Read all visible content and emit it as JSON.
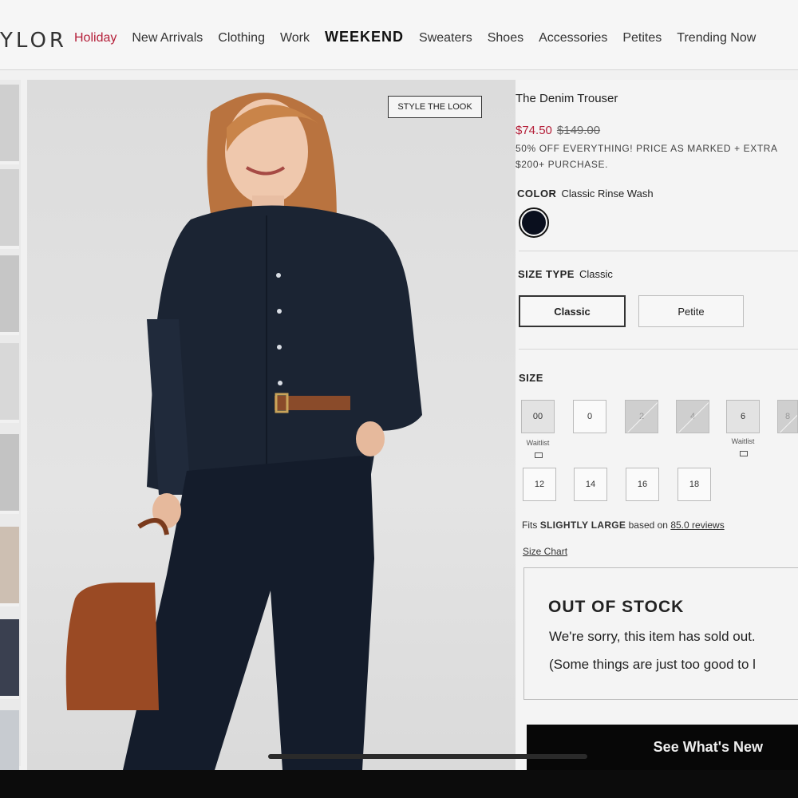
{
  "nav": {
    "brand": "YLOR",
    "links": [
      "Holiday",
      "New Arrivals",
      "Clothing",
      "Work",
      "WEEKEND",
      "Sweaters",
      "Shoes",
      "Accessories",
      "Petites",
      "Trending Now"
    ]
  },
  "photo": {
    "style_the_look": "STYLE THE LOOK"
  },
  "product": {
    "name": "The Denim Trouser",
    "sale_price": "$74.50",
    "original_price": "$149.00",
    "promo_line1": "50% OFF EVERYTHING! PRICE AS MARKED + EXTRA",
    "promo_line2": "$200+ PURCHASE.",
    "color_label": "COLOR",
    "color_value": "Classic Rinse Wash",
    "swatch_color": "#0a0f1e",
    "size_type_label": "SIZE TYPE",
    "size_type_value": "Classic",
    "size_types": [
      "Classic",
      "Petite"
    ],
    "size_label": "SIZE",
    "sizes_row1": [
      "00",
      "0",
      "2",
      "4",
      "6",
      "8"
    ],
    "sizes_row2": [
      "12",
      "14",
      "16",
      "18"
    ],
    "waitlist": "Waitlist",
    "fits_prefix": "Fits",
    "fits_value": "SLIGHTLY LARGE",
    "fits_middle": "based on",
    "fits_reviews": "85.0 reviews",
    "size_chart": "Size Chart"
  },
  "stock": {
    "title": "OUT OF STOCK",
    "line1": "We're sorry, this item has sold out.",
    "line2": "(Some things are just too good to l"
  },
  "cta": {
    "label": "See What's New"
  },
  "colors": {
    "accent": "#b5203a",
    "dark": "#070707"
  }
}
